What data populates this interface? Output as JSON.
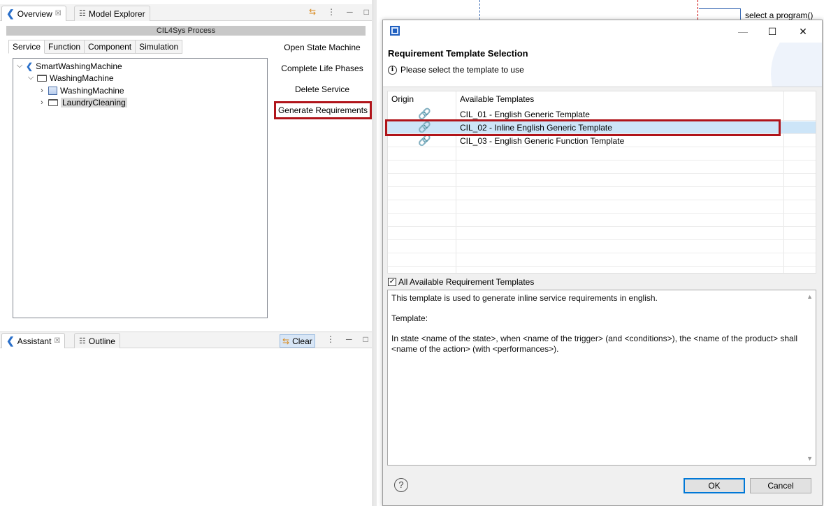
{
  "left_view": {
    "tabs": [
      {
        "label": "Overview",
        "close": "☒"
      },
      {
        "label": "Model Explorer"
      }
    ],
    "toolbar_icons": [
      "sync-icon",
      "view-menu-icon",
      "minimize-icon",
      "maximize-icon"
    ],
    "process_title": "CIL4Sys Process",
    "sub_tabs": [
      "Service",
      "Function",
      "Component",
      "Simulation"
    ],
    "tree": [
      {
        "label": "SmartWashingMachine",
        "toggle": "⌵"
      },
      {
        "label": "WashingMachine",
        "toggle": "⌵"
      },
      {
        "label": "WashingMachine",
        "toggle": "›"
      },
      {
        "label": "LaundryCleaning",
        "toggle": "›"
      }
    ],
    "actions": [
      "Open State Machine",
      "Complete Life Phases",
      "Delete Service",
      "Generate Requirements"
    ]
  },
  "assistant_view": {
    "tabs": [
      {
        "label": "Assistant",
        "close": "☒"
      },
      {
        "label": "Outline"
      }
    ],
    "clear_label": "Clear"
  },
  "background_editor": {
    "program_label": "select a program()"
  },
  "dialog": {
    "heading": "Requirement Template Selection",
    "info": "Please select the template to use",
    "columns": {
      "origin": "Origin",
      "templates": "Available Templates"
    },
    "rows": [
      {
        "name": "CIL_01 - English Generic Template",
        "selected": false
      },
      {
        "name": "CIL_02 - Inline English Generic Template",
        "selected": true
      },
      {
        "name": "CIL_03 - English Generic Function Template",
        "selected": false
      }
    ],
    "checkbox_label": "All Available Requirement Templates",
    "description": {
      "line1": "This template is used to generate inline service requirements in english.",
      "line2": "Template:",
      "line3": "In state <name of the state>, when <name of the trigger> (and <conditions>), the <name of the product> shall <name of the action> (with <performances>)."
    },
    "ok_label": "OK",
    "cancel_label": "Cancel"
  },
  "colors": {
    "highlight": "#b0141a",
    "selection": "#cde5f8",
    "accent": "#0078d7"
  }
}
